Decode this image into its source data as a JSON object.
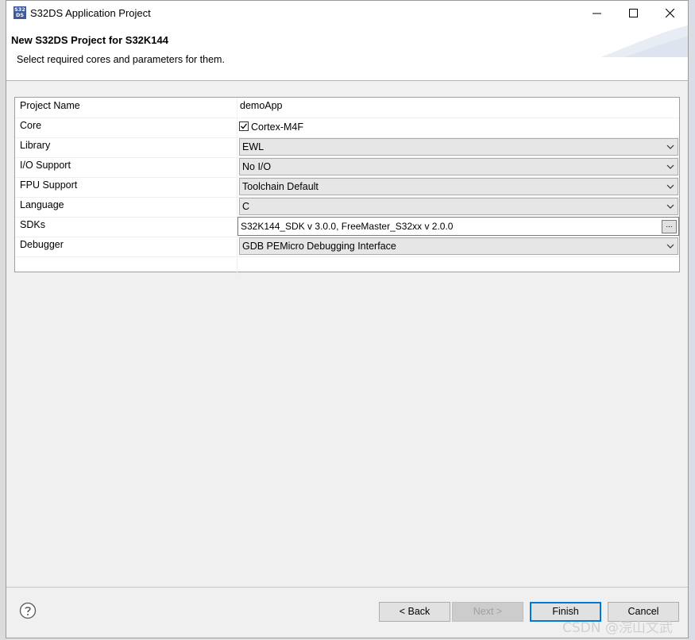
{
  "window": {
    "title": "S32DS Application Project",
    "icon_text": "S32 DS"
  },
  "banner": {
    "title": "New S32DS Project for S32K144",
    "description": "Select required cores and parameters for them."
  },
  "properties": [
    {
      "label": "Project Name",
      "type": "text",
      "value": "demoApp"
    },
    {
      "label": "Core",
      "type": "checkbox",
      "value": "Cortex-M4F",
      "checked": true
    },
    {
      "label": "Library",
      "type": "combo",
      "value": "EWL"
    },
    {
      "label": "I/O Support",
      "type": "combo",
      "value": "No I/O"
    },
    {
      "label": "FPU Support",
      "type": "combo",
      "value": "Toolchain Default"
    },
    {
      "label": "Language",
      "type": "combo",
      "value": "C"
    },
    {
      "label": "SDKs",
      "type": "browse",
      "value": "S32K144_SDK v 3.0.0, FreeMaster_S32xx v 2.0.0",
      "button": "..."
    },
    {
      "label": "Debugger",
      "type": "combo",
      "value": "GDB PEMicro Debugging Interface"
    }
  ],
  "buttons": {
    "back": "< Back",
    "next": "Next >",
    "finish": "Finish",
    "cancel": "Cancel"
  },
  "watermark": "CSDN @浣山文武",
  "colors": {
    "accent": "#0078d7",
    "dialog_bg": "#f0f0f0"
  }
}
